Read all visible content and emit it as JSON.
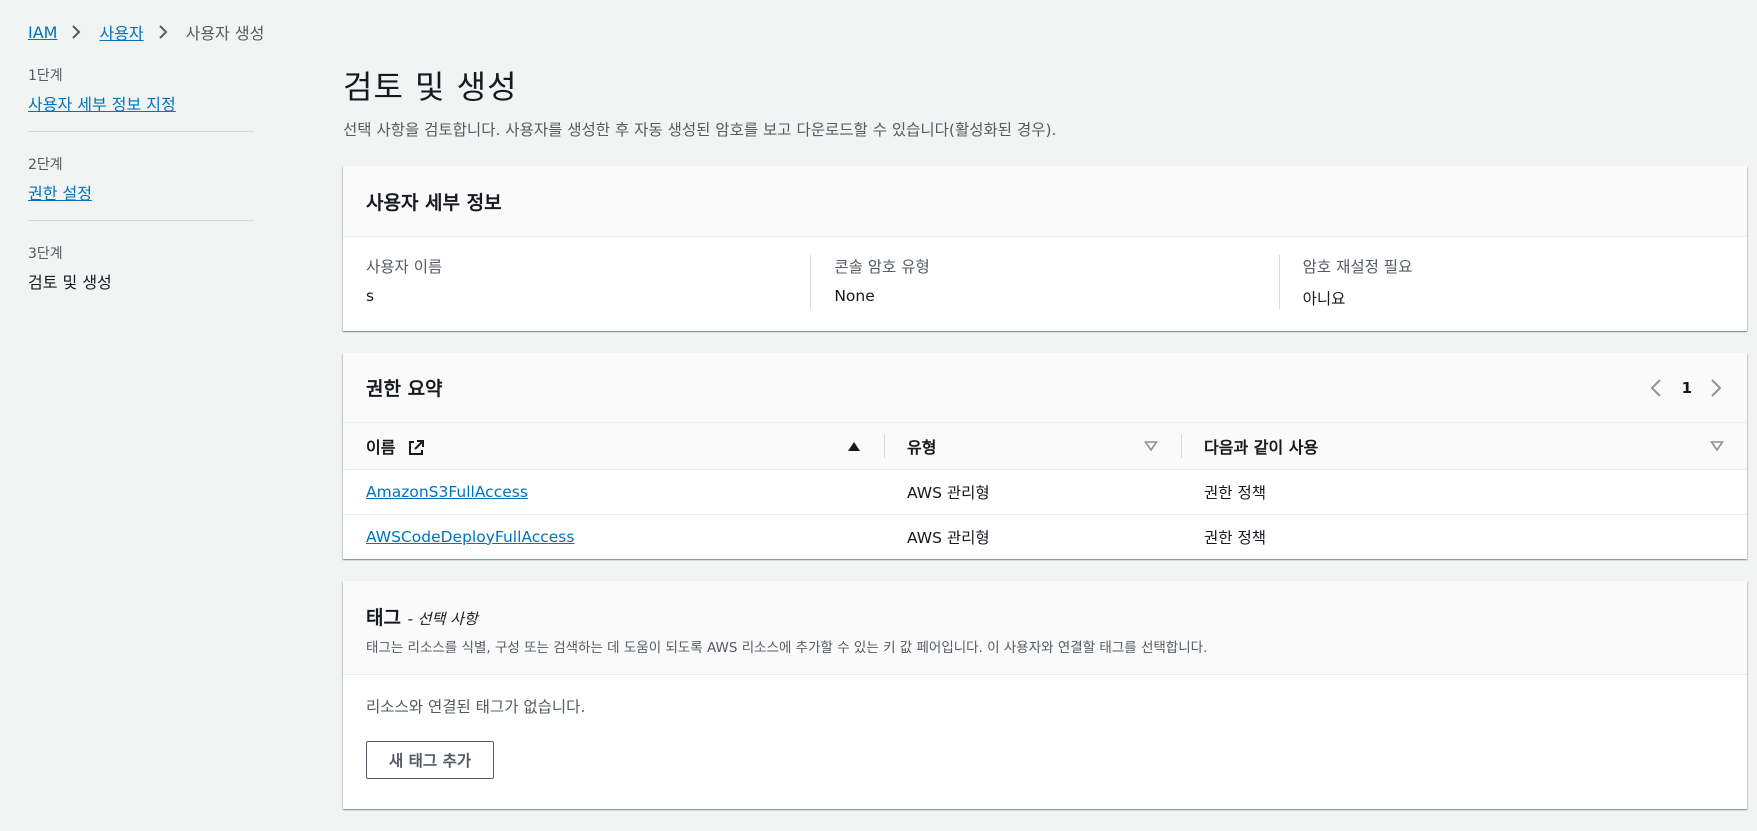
{
  "breadcrumb": {
    "items": [
      {
        "label": "IAM"
      },
      {
        "label": "사용자"
      },
      {
        "label": "사용자 생성"
      }
    ]
  },
  "steps": [
    {
      "num": "1단계",
      "title": "사용자 세부 정보 지정"
    },
    {
      "num": "2단계",
      "title": "권한 설정"
    },
    {
      "num": "3단계",
      "title": "검토 및 생성"
    }
  ],
  "main": {
    "title": "검토 및 생성",
    "description": "선택 사항을 검토합니다. 사용자를 생성한 후 자동 생성된 암호를 보고 다운로드할 수 있습니다(활성화된 경우)."
  },
  "details": {
    "title": "사용자 세부 정보",
    "fields": [
      {
        "label": "사용자 이름",
        "value": "s"
      },
      {
        "label": "콘솔 암호 유형",
        "value": "None"
      },
      {
        "label": "암호 재설정 필요",
        "value": "아니요"
      }
    ]
  },
  "permissions": {
    "title": "권한 요약",
    "page": "1",
    "columns": [
      "이름",
      "유형",
      "다음과 같이 사용"
    ],
    "rows": [
      {
        "name": "AmazonS3FullAccess",
        "type": "AWS 관리형",
        "used_as": "권한 정책"
      },
      {
        "name": "AWSCodeDeployFullAccess",
        "type": "AWS 관리형",
        "used_as": "권한 정책"
      }
    ]
  },
  "tags": {
    "title": "태그",
    "optional": "- 선택 사항",
    "description": "태그는 리소스를 식별, 구성 또는 검색하는 데 도움이 되도록 AWS 리소스에 추가할 수 있는 키 값 페어입니다. 이 사용자와 연결할 태그를 선택합니다.",
    "empty": "리소스와 연결된 태그가 없습니다.",
    "add_button": "새 태그 추가"
  }
}
